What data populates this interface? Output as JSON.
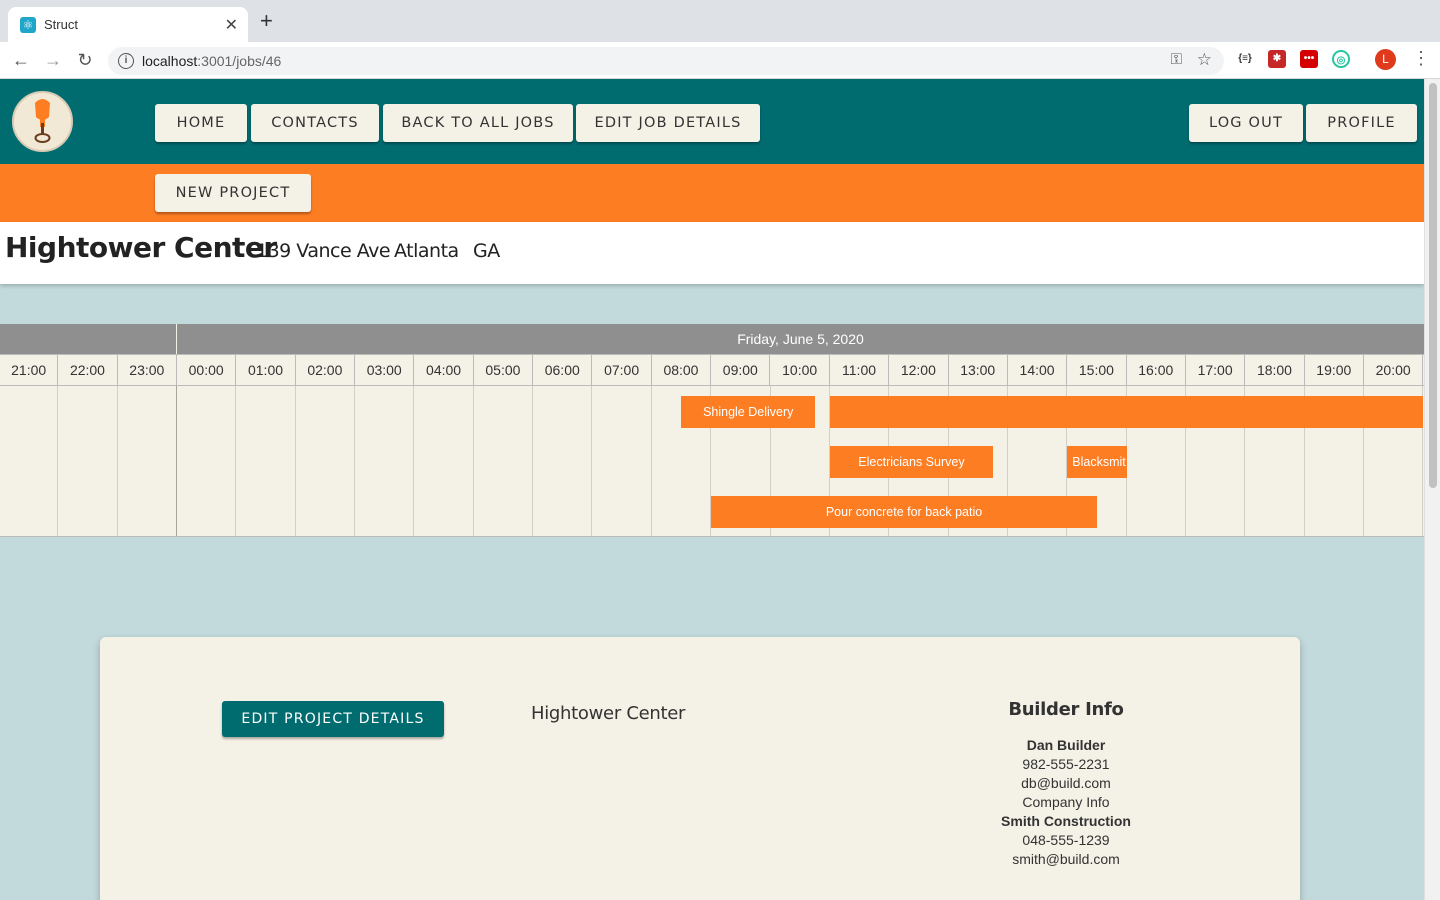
{
  "browser": {
    "tab_title": "Struct",
    "url_host": "localhost",
    "url_path": ":3001/jobs/46",
    "avatar_letter": "L"
  },
  "nav": {
    "home": "HOME",
    "contacts": "CONTACTS",
    "back": "BACK TO ALL JOBS",
    "edit_job": "EDIT JOB DETAILS",
    "logout": "LOG OUT",
    "profile": "PROFILE",
    "new_project": "NEW PROJECT"
  },
  "job": {
    "name": "Hightower Center",
    "street": "139 Vance Ave",
    "city": "Atlanta",
    "state": "GA"
  },
  "timeline": {
    "date": "Friday, June 5, 2020",
    "hours": [
      "21:00",
      "22:00",
      "23:00",
      "00:00",
      "01:00",
      "02:00",
      "03:00",
      "04:00",
      "05:00",
      "06:00",
      "07:00",
      "08:00",
      "09:00",
      "10:00",
      "11:00",
      "12:00",
      "13:00",
      "14:00",
      "15:00",
      "16:00",
      "17:00",
      "18:00",
      "19:00",
      "20:00"
    ],
    "events": [
      {
        "label": "Shingle Delivery",
        "start": "08:30",
        "end": "10:45"
      },
      {
        "label": "",
        "start": "11:00",
        "end": "21:00"
      },
      {
        "label": "Electricians Survey",
        "start": "11:00",
        "end": "13:45"
      },
      {
        "label": "Blacksmit",
        "start": "15:00",
        "end": "16:00"
      },
      {
        "label": "Pour concrete for back patio",
        "start": "09:00",
        "end": "15:30"
      }
    ]
  },
  "card": {
    "edit_button": "EDIT PROJECT DETAILS",
    "project_name": "Hightower Center",
    "builder_title": "Builder Info",
    "builder_name": "Dan Builder",
    "builder_phone": "982-555-2231",
    "builder_email": "db@build.com",
    "company_heading": "Company Info",
    "company_name": "Smith Construction",
    "company_phone": "048-555-1239",
    "company_email": "smith@build.com"
  },
  "colors": {
    "teal": "#006c70",
    "orange": "#fd7d23",
    "cream": "#f4f1e6",
    "background": "#c3dadd"
  }
}
